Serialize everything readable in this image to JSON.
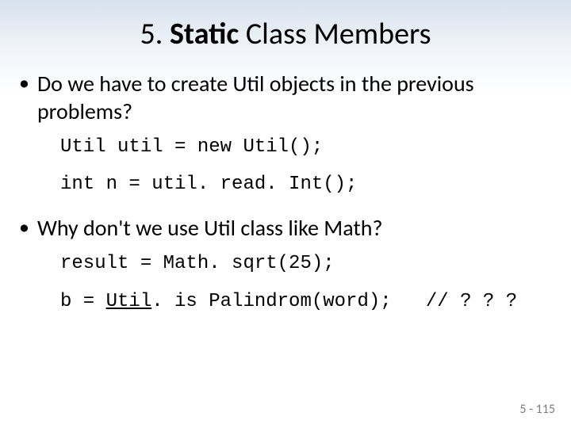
{
  "title": {
    "prefix": "5. ",
    "bold": "Static",
    "suffix": " Class Members"
  },
  "bullets": [
    "Do we have to create Util objects in the previous problems?",
    "Why don't we use Util class like Math?"
  ],
  "code1": [
    "Util util = new Util();",
    "int n = util. read. Int();"
  ],
  "code2_line1": "result = Math. sqrt(25);",
  "code2_line2": {
    "pre": "b = ",
    "underlined": "Util",
    "post": ". is Palindrom(word);   // ? ? ?"
  },
  "page_number": "5 - 115"
}
